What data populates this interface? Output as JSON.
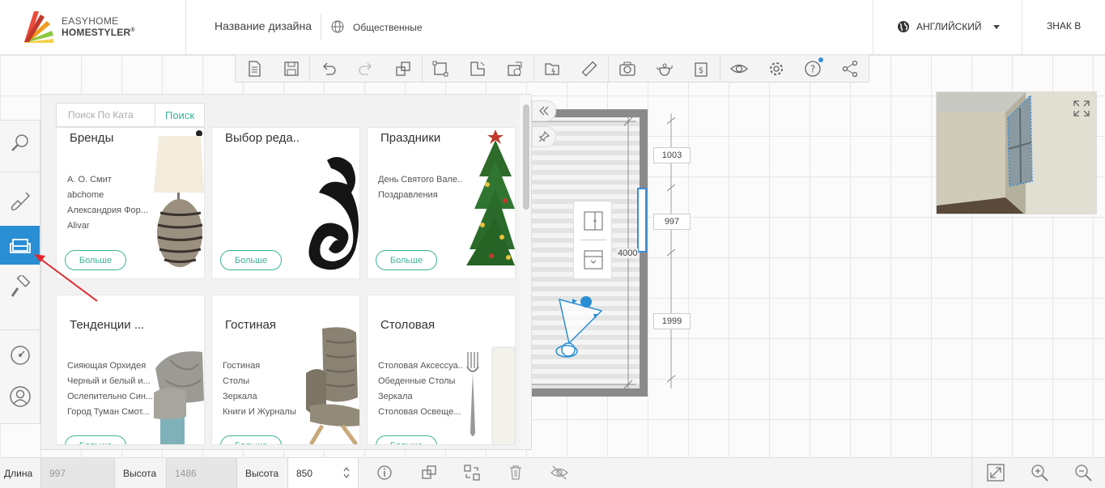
{
  "header": {
    "logo_line1": "EASYHOME",
    "logo_line2": "HOMESTYLER",
    "logo_trademark": "®",
    "design_name": "Название дизайна",
    "visibility": "Общественные",
    "language": "АНГЛИЙСКИЙ",
    "sign_in": "ЗНАК В"
  },
  "toolbar": {
    "icons": [
      "new-file-icon",
      "save-icon",
      "undo-icon",
      "redo-icon",
      "copy-icon",
      "draw-room-icon",
      "draw-wall-icon",
      "import-icon",
      "folder-icon",
      "measure-icon",
      "camera-icon",
      "teapot-icon",
      "price-icon",
      "view-icon",
      "settings-icon",
      "help-icon",
      "share-icon"
    ]
  },
  "catalog": {
    "search_placeholder": "Поиск По Ката",
    "search_button": "Поиск",
    "more_label": "Больше",
    "cards": [
      {
        "title": "Бренды",
        "links": [
          "А. О. Смит",
          "abchome",
          "Александрия Фор...",
          "Alivar"
        ]
      },
      {
        "title": "Выбор реда..",
        "links": []
      },
      {
        "title": "Праздники",
        "links": [
          "День Святого Вале..",
          "Поздравления"
        ]
      },
      {
        "title": "Тенденции ...",
        "links": [
          "Сияющая Орхидея",
          "Черный и белый и...",
          "Ослепительно Син...",
          "Город Туман Смот..."
        ]
      },
      {
        "title": "Гостиная",
        "links": [
          "Гостиная",
          "Столы",
          "Зеркала",
          "Книги И Журналы"
        ]
      },
      {
        "title": "Столовая",
        "links": [
          "Столовая Аксессуа..",
          "Обеденные Столы",
          "Зеркала",
          "Столовая Освеще..."
        ]
      }
    ]
  },
  "floorplan": {
    "dims": [
      "1003",
      "997",
      "1999"
    ],
    "width_label": "4000"
  },
  "bottom": {
    "length_label": "Длина",
    "length_value": "997",
    "height_label": "Высота",
    "height_value": "1486",
    "elev_label": "Высота",
    "elev_value": "850"
  },
  "colors": {
    "accent": "#2a8ed4",
    "green": "#3bb39a"
  }
}
